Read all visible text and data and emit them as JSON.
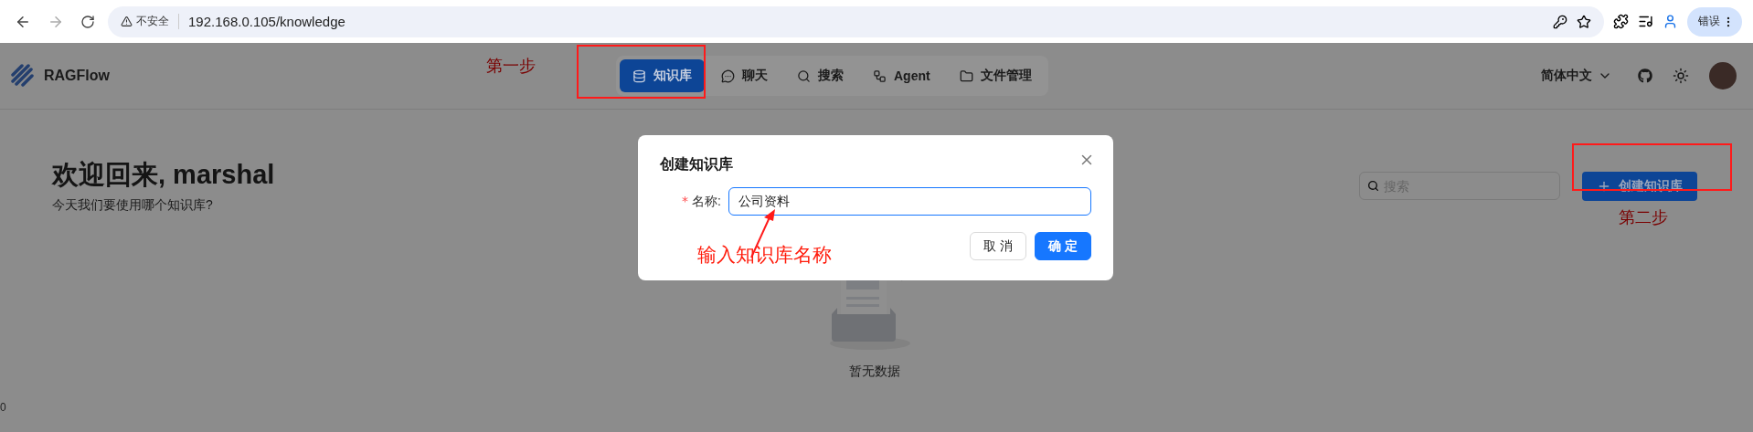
{
  "browser": {
    "security": "不安全",
    "url": "192.168.0.105/knowledge",
    "profile_button": "错误"
  },
  "header": {
    "logo": "RAGFlow",
    "nav": [
      {
        "label": "知识库",
        "selected": true
      },
      {
        "label": "聊天",
        "selected": false
      },
      {
        "label": "搜索",
        "selected": false
      },
      {
        "label": "Agent",
        "selected": false
      },
      {
        "label": "文件管理",
        "selected": false
      }
    ],
    "language": "简体中文"
  },
  "main": {
    "title": "欢迎回来, marshal",
    "subtitle": "今天我们要使用哪个知识库?",
    "search": {
      "placeholder": "搜索"
    },
    "create_button": "创建知识库",
    "empty_text": "暂无数据",
    "edge_text": "0"
  },
  "dialog": {
    "title": "创建知识库",
    "field": {
      "required_mark": "*",
      "label": "名称:",
      "value": "公司资料"
    },
    "buttons": [
      {
        "label": "取 消",
        "kind": "default"
      },
      {
        "label": "确 定",
        "kind": "primary"
      }
    ]
  },
  "annotations": [
    {
      "kind": "box"
    },
    {
      "kind": "text",
      "text": "第一步"
    },
    {
      "kind": "box"
    },
    {
      "kind": "text",
      "text": "第二步"
    },
    {
      "kind": "text",
      "text": "输入知识库名称"
    },
    {
      "kind": "arrow"
    }
  ]
}
